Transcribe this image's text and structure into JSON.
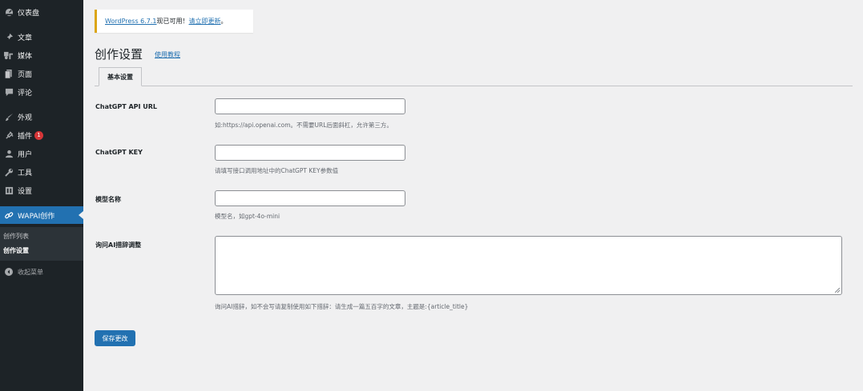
{
  "sidebar": {
    "items": [
      {
        "label": "仪表盘",
        "icon": "dashboard-icon"
      },
      {
        "label": "文章",
        "icon": "pin-icon"
      },
      {
        "label": "媒体",
        "icon": "media-icon"
      },
      {
        "label": "页面",
        "icon": "page-icon"
      },
      {
        "label": "评论",
        "icon": "comment-icon"
      },
      {
        "label": "外观",
        "icon": "brush-icon"
      },
      {
        "label": "插件",
        "icon": "plugin-icon",
        "badge": "1"
      },
      {
        "label": "用户",
        "icon": "user-icon"
      },
      {
        "label": "工具",
        "icon": "wrench-icon"
      },
      {
        "label": "设置",
        "icon": "settings-icon"
      },
      {
        "label": "WAPAI创作",
        "icon": "link-icon"
      }
    ],
    "submenu": [
      "创作列表",
      "创作设置"
    ],
    "collapse": "收起菜单"
  },
  "notice": {
    "version_link": "WordPress 6.7.1",
    "text": " 现已可用！",
    "update_link": "请立即更新",
    "suffix": "。"
  },
  "page": {
    "title": "创作设置",
    "tutorial": "使用教程",
    "tab": "基本设置"
  },
  "fields": [
    {
      "label": "ChatGPT API URL",
      "value": "",
      "help": "如:https://api.openai.com。不需要URL后面斜杠，允许第三方。"
    },
    {
      "label": "ChatGPT KEY",
      "value": "",
      "help": "请填写接口调用地址中的ChatGPT KEY参数值"
    },
    {
      "label": "模型名称",
      "value": "",
      "help": "模型名，如gpt-4o-mini"
    },
    {
      "label": "询问AI措辞调整",
      "value": "",
      "help": "询问AI措辞，如不会写请复制使用如下措辞：请生成一篇五百字的文章，主题是:{article_title}"
    }
  ],
  "save_button": "保存更改",
  "colors": {
    "accent": "#2271b1",
    "sidebar": "#1d2327",
    "notice_border": "#dba617",
    "badge": "#d63638"
  }
}
